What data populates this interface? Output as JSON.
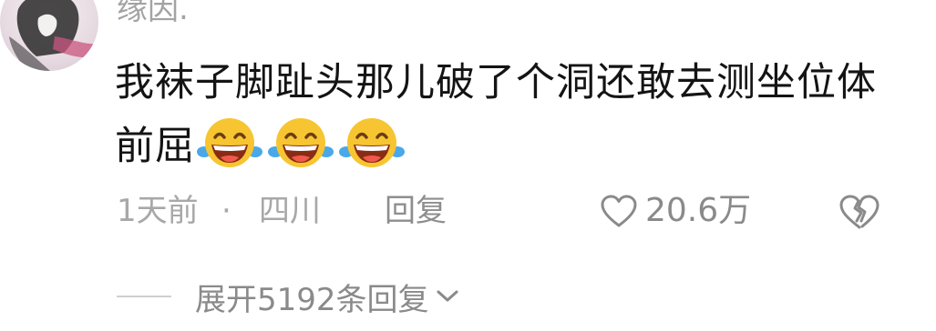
{
  "comment": {
    "username": "缘因.",
    "text": "我袜子脚趾头那儿破了个洞还敢去测坐位体前屈",
    "emojis": [
      "laughing-crying-emoji",
      "laughing-crying-emoji",
      "laughing-crying-emoji"
    ],
    "meta": {
      "time": "1天前",
      "separator": "·",
      "location": "四川",
      "reply_label": "回复"
    },
    "likes": {
      "count": "20.6万",
      "icon": "heart-outline-icon"
    },
    "dislike_icon": "broken-heart-icon",
    "replies": {
      "expand_label": "展开5192条回复",
      "icon": "chevron-down-icon"
    }
  },
  "colors": {
    "username": "#a3a3a3",
    "text": "#141414",
    "meta": "#a8a8a8",
    "emoji_face": "#f7c531"
  }
}
